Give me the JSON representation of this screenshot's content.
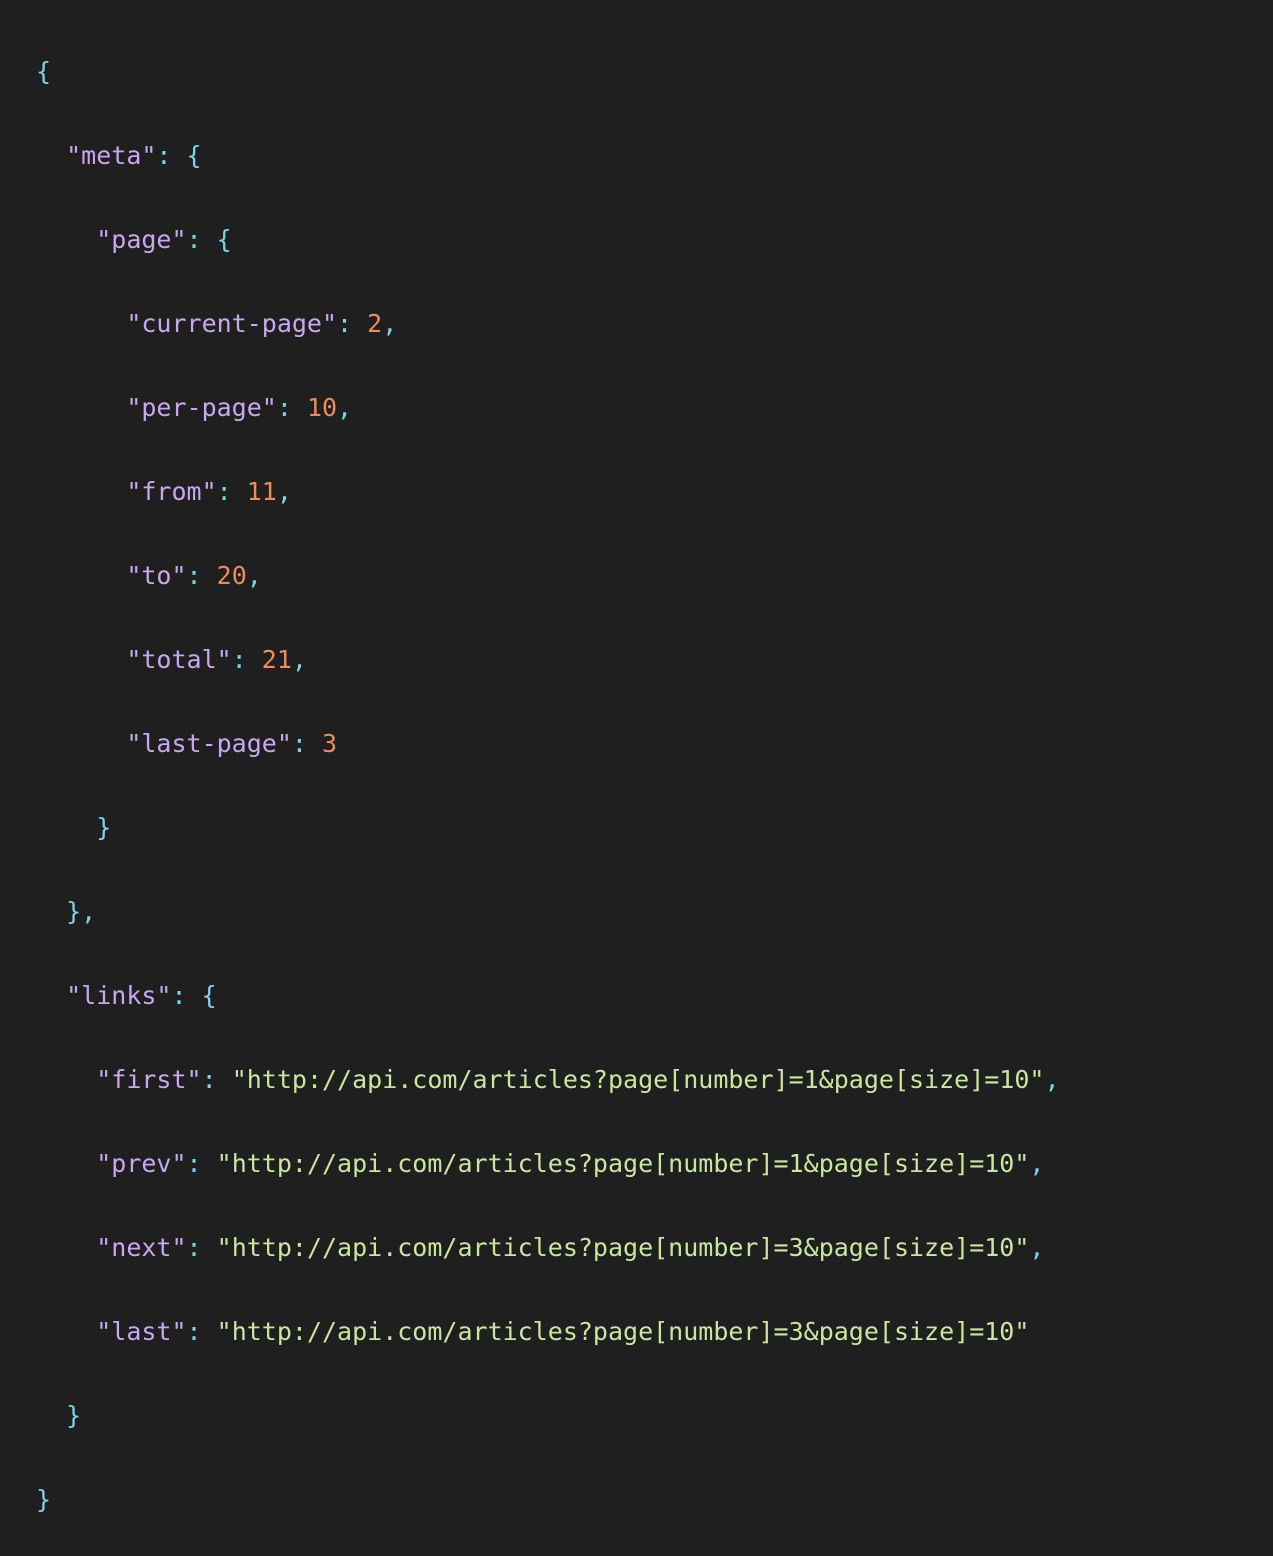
{
  "colors": {
    "background": "#1f1f1f",
    "punctuation": "#7dd3e8",
    "key": "#c9a7f0",
    "number": "#f08a5d",
    "string": "#c8e6a0"
  },
  "json": {
    "meta_key": "\"meta\"",
    "page_key": "\"page\"",
    "current_page_key": "\"current-page\"",
    "current_page_value": "2",
    "per_page_key": "\"per-page\"",
    "per_page_value": "10",
    "from_key": "\"from\"",
    "from_value": "11",
    "to_key": "\"to\"",
    "to_value": "20",
    "total_key": "\"total\"",
    "total_value": "21",
    "last_page_key": "\"last-page\"",
    "last_page_value": "3",
    "links_key": "\"links\"",
    "first_key": "\"first\"",
    "first_value": "\"http://api.com/articles?page[number]=1&page[size]=10\"",
    "prev_key": "\"prev\"",
    "prev_value": "\"http://api.com/articles?page[number]=1&page[size]=10\"",
    "next_key": "\"next\"",
    "next_value": "\"http://api.com/articles?page[number]=3&page[size]=10\"",
    "last_key": "\"last\"",
    "last_value": "\"http://api.com/articles?page[number]=3&page[size]=10\""
  }
}
